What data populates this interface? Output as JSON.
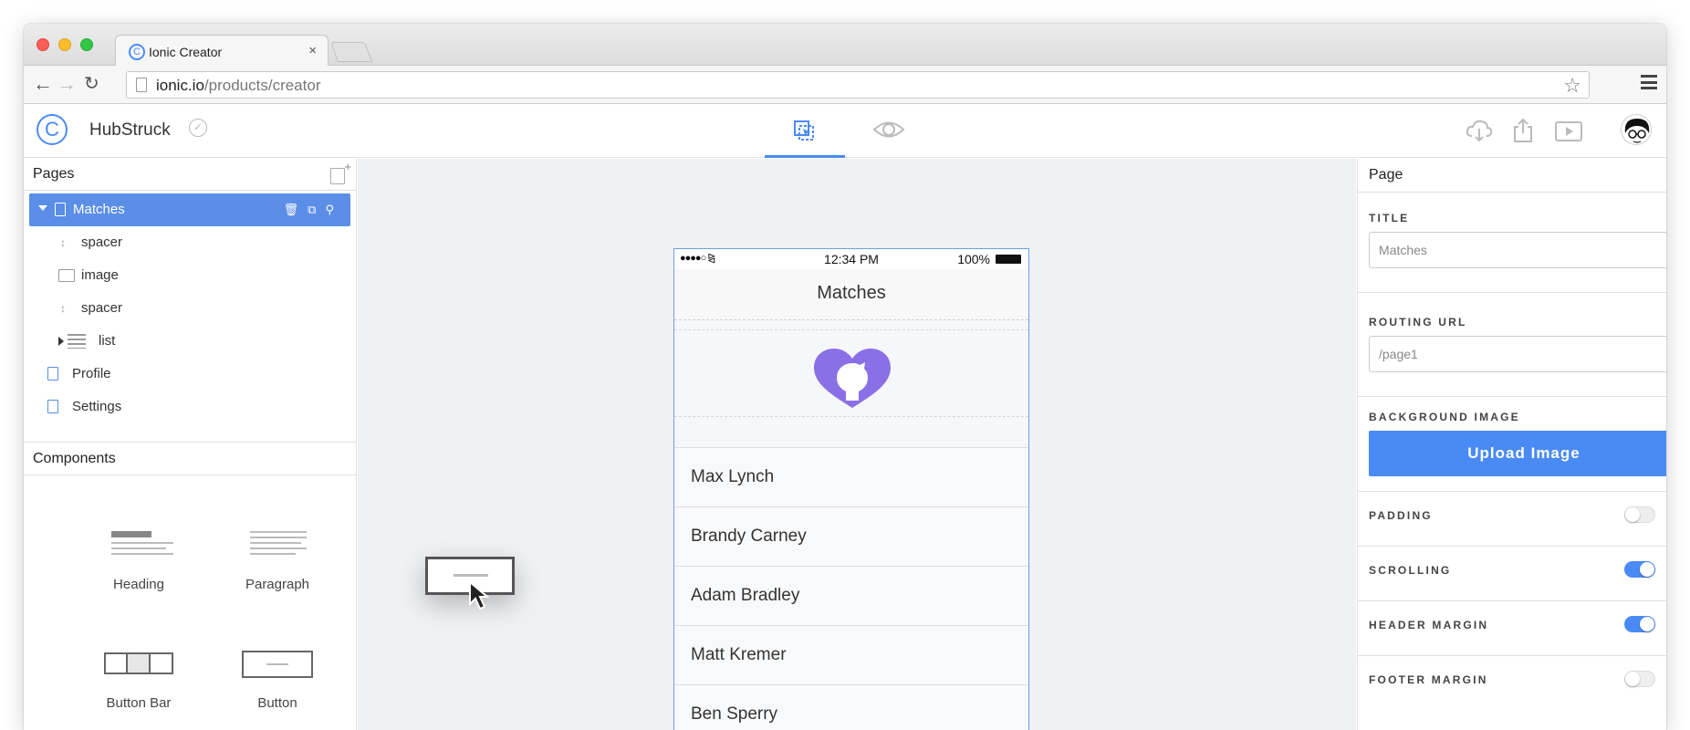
{
  "browser": {
    "tab_title": "Ionic Creator",
    "tab_close": "×",
    "url_host": "ionic.io",
    "url_path": "/products/creator"
  },
  "app": {
    "project_name": "HubStruck",
    "logo_glyph": "C",
    "accent_color": "#4a8af4"
  },
  "pages_panel": {
    "title": "Pages",
    "tree": [
      {
        "label": "Matches",
        "type": "page",
        "selected": true,
        "expanded": true
      },
      {
        "label": "spacer",
        "type": "spacer"
      },
      {
        "label": "image",
        "type": "image"
      },
      {
        "label": "spacer",
        "type": "spacer"
      },
      {
        "label": "list",
        "type": "list",
        "collapsed": true
      },
      {
        "label": "Profile",
        "type": "page"
      },
      {
        "label": "Settings",
        "type": "page"
      }
    ]
  },
  "components_panel": {
    "title": "Components",
    "items": [
      {
        "label": "Heading",
        "icon": "heading-icon"
      },
      {
        "label": "Paragraph",
        "icon": "paragraph-icon"
      },
      {
        "label": "Button Bar",
        "icon": "button-bar-icon"
      },
      {
        "label": "Button",
        "icon": "button-icon"
      }
    ]
  },
  "phone": {
    "status_time": "12:34 PM",
    "status_battery": "100%",
    "title": "Matches",
    "list": [
      "Max Lynch",
      "Brandy Carney",
      "Adam Bradley",
      "Matt Kremer",
      "Ben Sperry"
    ],
    "hero_color": "#8b6fe6"
  },
  "properties_panel": {
    "title": "Page",
    "title_label": "TITLE",
    "title_value": "Matches",
    "routing_label": "ROUTING URL",
    "routing_value": "/page1",
    "bg_label": "BACKGROUND IMAGE",
    "upload_button": "Upload Image",
    "toggles": [
      {
        "label": "PADDING",
        "on": false
      },
      {
        "label": "SCROLLING",
        "on": true
      },
      {
        "label": "HEADER MARGIN",
        "on": true
      },
      {
        "label": "FOOTER MARGIN",
        "on": false
      }
    ]
  }
}
